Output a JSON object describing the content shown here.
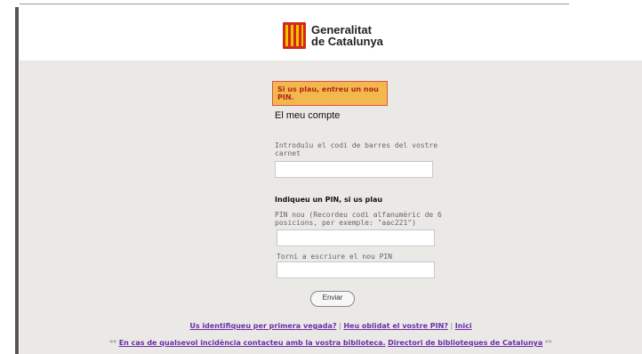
{
  "logo": {
    "line1": "Generalitat",
    "line2": "de Catalunya"
  },
  "alert": {
    "text": "Si us plau, entreu un nou PIN."
  },
  "page": {
    "heading": "El meu compte"
  },
  "form": {
    "barcode_label": "Introduïu el codi de barres del vostre carnet",
    "barcode_value": "",
    "pin_section_title": "Indiqueu un PIN, si us plau",
    "pin_label": "PIN nou (Recordeu codi alfanumèric de 6 posicions, per exemple: \"aac221\")",
    "pin_value": "",
    "pin_confirm_label": "Torni a escriure el nou PIN",
    "pin_confirm_value": "",
    "submit_label": "Enviar"
  },
  "links": {
    "first_time": "Us identifiqueu per primera vegada?",
    "forgot_pin": "Heu oblidat el vostre PIN?",
    "home": "Inici",
    "separator": "|"
  },
  "footer": {
    "prefix": "**",
    "contact": "En cas de qualsevol incidència contacteu amb la vostra biblioteca.",
    "directory": "Directori de biblioteques de Catalunya",
    "suffix": "**"
  },
  "colors": {
    "alert_bg": "#f2b84b",
    "alert_text": "#b0241e",
    "link": "#6b2fa8",
    "background": "#ebe9e6"
  }
}
